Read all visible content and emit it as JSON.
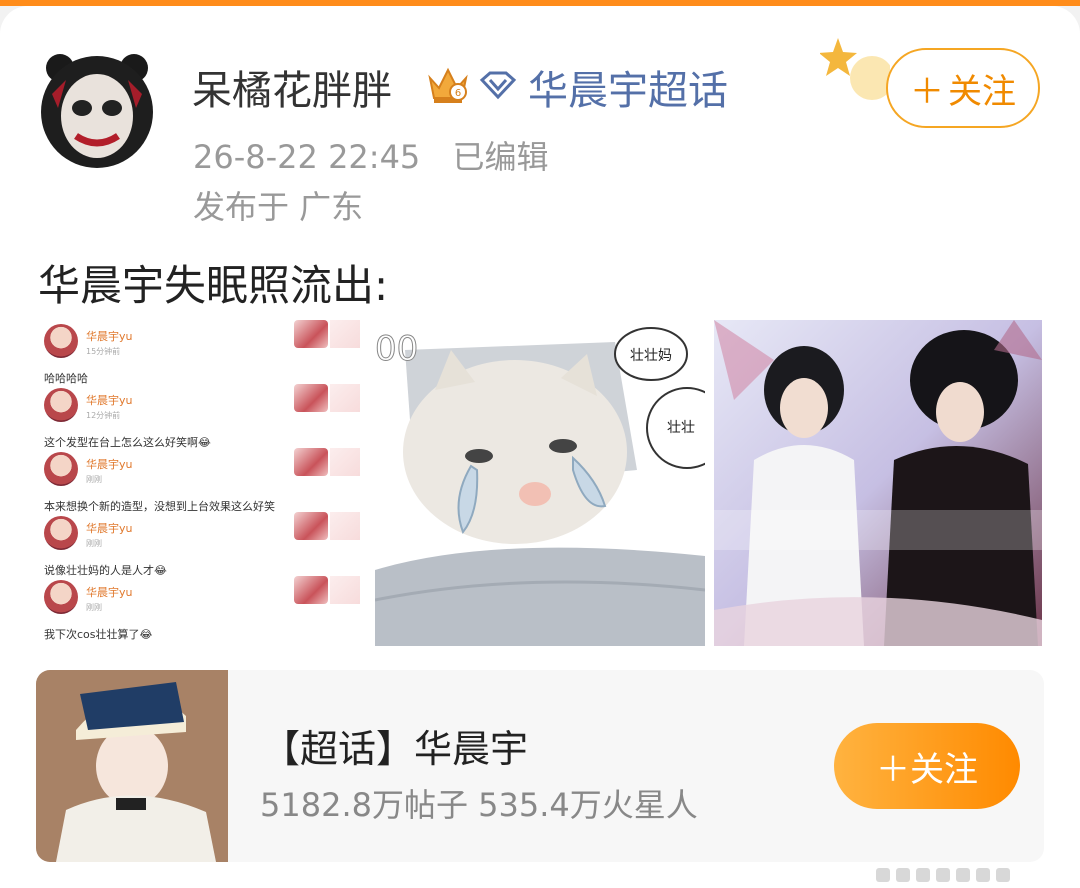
{
  "post": {
    "username": "呆橘花胖胖",
    "topic": "华晨宇超话",
    "follow_label": "关注",
    "time": "26-8-22 22:45",
    "edited": "已编辑",
    "location": "发布于 广东",
    "text": "华晨宇失眠照流出:"
  },
  "image1": {
    "rows": [
      {
        "name": "华晨宇yu",
        "when": "15分钟前",
        "message": "哈哈哈哈"
      },
      {
        "name": "华晨宇yu",
        "when": "12分钟前",
        "message": "这个发型在台上怎么这么好笑啊😂"
      },
      {
        "name": "华晨宇yu",
        "when": "刚刚",
        "message": "本来想换个新的造型，没想到上台效果这么好笑"
      },
      {
        "name": "华晨宇yu",
        "when": "刚刚",
        "message": "说像壮壮妈的人是人才😂"
      },
      {
        "name": "华晨宇yu",
        "when": "刚刚",
        "message": "我下次cos壮壮算了😂"
      }
    ]
  },
  "image2": {
    "bubble1": "壮壮妈",
    "bubble2": "壮壮"
  },
  "topic_card": {
    "title": "【超话】华晨宇",
    "stats": "5182.8万帖子 535.4万火星人",
    "follow_label": "关注"
  },
  "colors": {
    "accent": "#ff8a00",
    "link": "#5470a8"
  }
}
